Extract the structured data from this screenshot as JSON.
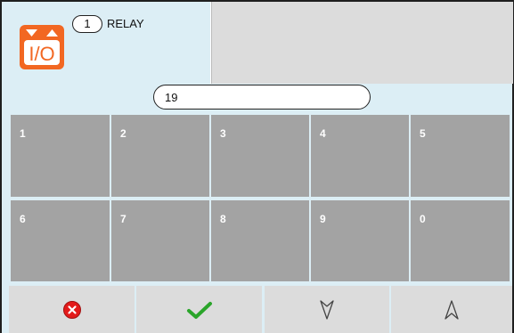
{
  "header": {
    "relay_number": "1",
    "relay_label": "RELAY",
    "icon": "io-relay-icon"
  },
  "input": {
    "value": "19"
  },
  "keypad": {
    "keys": [
      "1",
      "2",
      "3",
      "4",
      "5",
      "6",
      "7",
      "8",
      "9",
      "0"
    ]
  },
  "toolbar": {
    "buttons": [
      "cancel-icon",
      "confirm-check-icon",
      "arrow-down-icon",
      "arrow-up-icon"
    ]
  },
  "colors": {
    "header_bg": "#dceef5",
    "key_bg": "#a3a3a3",
    "icon_orange": "#f26722",
    "cancel_red": "#e31b1b",
    "check_green": "#2aa52a"
  }
}
